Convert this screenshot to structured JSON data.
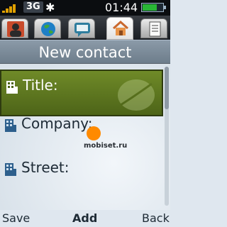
{
  "status": {
    "network": "3G",
    "time": "01:44",
    "battery_level": 0.7
  },
  "tabs": [
    {
      "name": "contact-photo",
      "active": false
    },
    {
      "name": "globe",
      "active": false
    },
    {
      "name": "message",
      "active": false
    },
    {
      "name": "home",
      "active": true
    },
    {
      "name": "notes",
      "active": false
    }
  ],
  "header": {
    "title": "New contact"
  },
  "fields": [
    {
      "label": "Title:"
    },
    {
      "label": "Company:"
    },
    {
      "label": "Street:"
    }
  ],
  "watermark": {
    "text": "mobiset.ru"
  },
  "softkeys": {
    "left": "Save",
    "middle": "Add",
    "right": "Back"
  }
}
